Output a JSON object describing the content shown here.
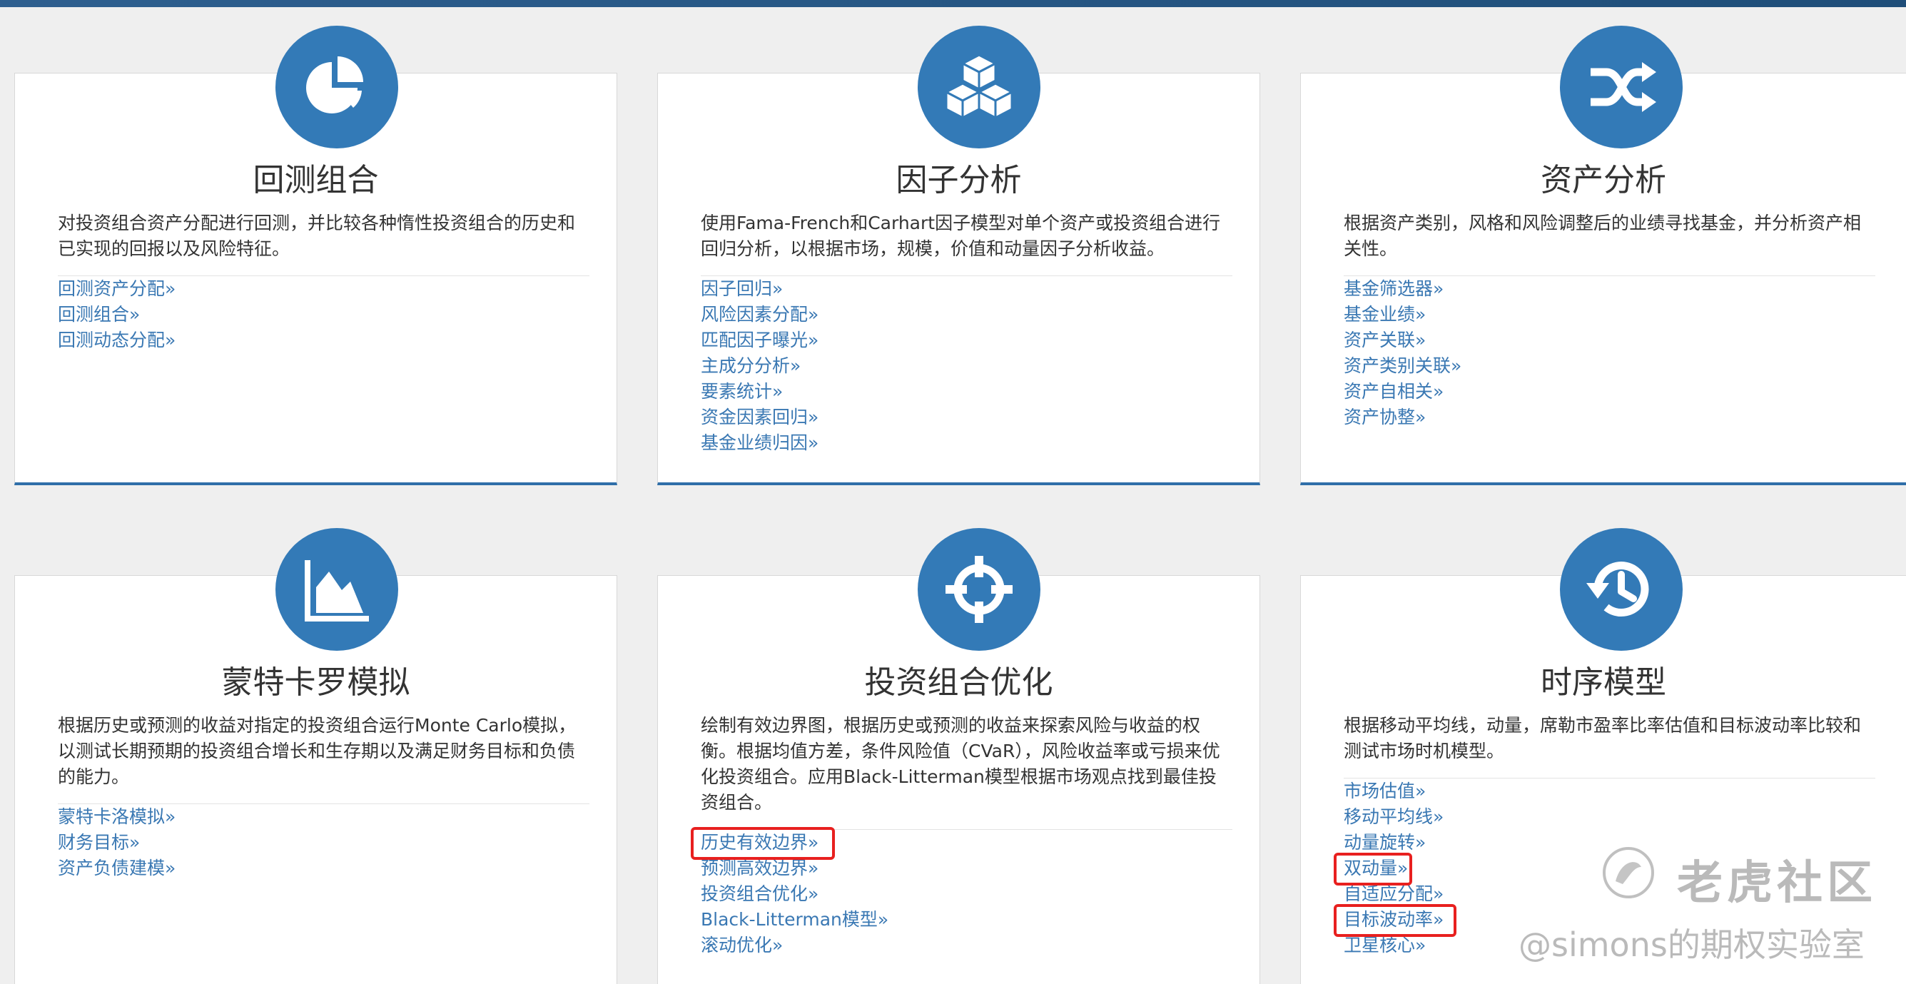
{
  "cards": [
    {
      "icon": "pie-chart-icon",
      "title": "回测组合",
      "description": "对投资组合资产分配进行回测，并比较各种惰性投资组合的历史和已实现的回报以及风险特征。",
      "links": [
        "回测资产分配»",
        "回测组合»",
        "回测动态分配»"
      ]
    },
    {
      "icon": "cubes-icon",
      "title": "因子分析",
      "description": "使用Fama-French和Carhart因子模型对单个资产或投资组合进行回归分析，以根据市场，规模，价值和动量因子分析收益。",
      "links": [
        "因子回归»",
        "风险因素分配»",
        "匹配因子曝光»",
        "主成分分析»",
        "要素统计»",
        "资金因素回归»",
        "基金业绩归因»"
      ]
    },
    {
      "icon": "shuffle-icon",
      "title": "资产分析",
      "description": "根据资产类别，风格和风险调整后的业绩寻找基金，并分析资产相关性。",
      "links": [
        "基金筛选器»",
        "基金业绩»",
        "资产关联»",
        "资产类别关联»",
        "资产自相关»",
        "资产协整»"
      ]
    },
    {
      "icon": "area-chart-icon",
      "title": "蒙特卡罗模拟",
      "description": "根据历史或预测的收益对指定的投资组合运行Monte Carlo模拟，以测试长期预期的投资组合增长和生存期以及满足财务目标和负债的能力。",
      "links": [
        "蒙特卡洛模拟»",
        "财务目标»",
        "资产负债建模»"
      ]
    },
    {
      "icon": "crosshair-icon",
      "title": "投资组合优化",
      "description": "绘制有效边界图，根据历史或预测的收益来探索风险与收益的权衡。根据均值方差，条件风险值（CVaR），风险收益率或亏损来优化投资组合。应用Black-Litterman模型根据市场观点找到最佳投资组合。",
      "links": [
        "历史有效边界»",
        "预测高效边界»",
        "投资组合优化»",
        "Black-Litterman模型»",
        "滚动优化»"
      ]
    },
    {
      "icon": "history-icon",
      "title": "时序模型",
      "description": "根据移动平均线，动量，席勒市盈率比率估值和目标波动率比较和测试市场时机模型。",
      "links": [
        "市场估值»",
        "移动平均线»",
        "动量旋转»",
        "双动量»",
        "自适应分配»",
        "目标波动率»",
        "卫星核心»"
      ]
    }
  ],
  "watermark": {
    "brand": "老虎社区",
    "author": "@simons的期权实验室"
  },
  "colors": {
    "accent": "#337ab7",
    "link": "#3a78b3",
    "highlight": "#e8201f"
  }
}
